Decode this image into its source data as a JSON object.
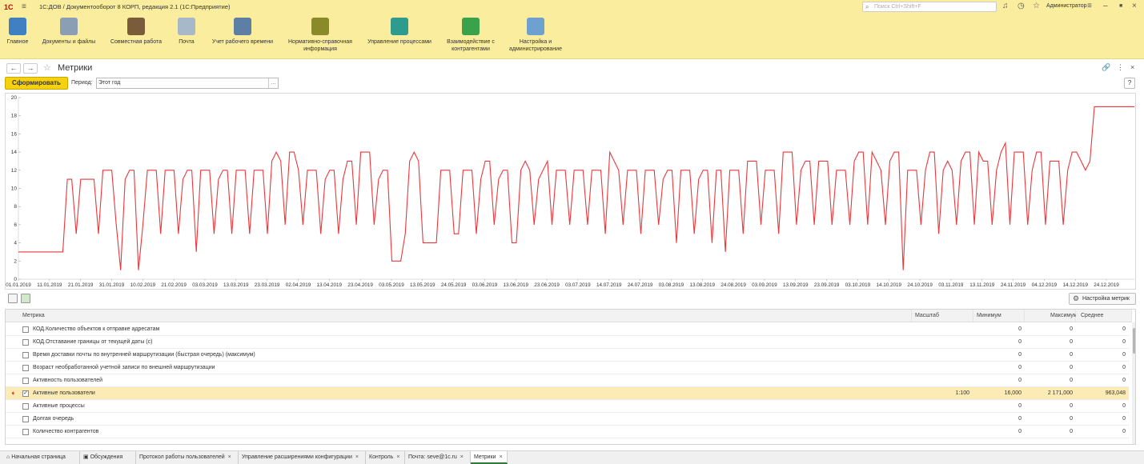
{
  "titlebar": {
    "logo": "1С",
    "title": "1С:ДОВ / Документооборот 8 КОРП, редакция 2.1  (1С:Предприятие)",
    "search_placeholder": "Поиск Ctrl+Shift+F",
    "user": "Администратор"
  },
  "sections": [
    {
      "label": "Главное",
      "color": "#3f7fc2"
    },
    {
      "label": "Документы и файлы",
      "color": "#8a9fb3"
    },
    {
      "label": "Совместная работа",
      "color": "#7a5c3a"
    },
    {
      "label": "Почта",
      "color": "#a7b8c9"
    },
    {
      "label": "Учет рабочего времени",
      "color": "#5d7fa6"
    },
    {
      "label": "Нормативно-справочная информация",
      "color": "#8a8a2a"
    },
    {
      "label": "Управление процессами",
      "color": "#2e9b8f"
    },
    {
      "label": "Взаимодействие с контрагентами",
      "color": "#3aa24a"
    },
    {
      "label": "Настройка и администрирование",
      "color": "#6ea0d0"
    }
  ],
  "form": {
    "title": "Метрики",
    "back": "←",
    "forward": "→",
    "star": "☆",
    "generate_label": "Сформировать",
    "period_label": "Период:",
    "period_value": "Этот год",
    "help": "?"
  },
  "chart_data": {
    "type": "line",
    "title": "",
    "ylim": [
      0,
      20
    ],
    "yticks": [
      0,
      2,
      4,
      6,
      8,
      10,
      12,
      14,
      16,
      18,
      20
    ],
    "xticks": [
      "01.01.2019",
      "11.01.2019",
      "21.01.2019",
      "31.01.2019",
      "10.02.2019",
      "21.02.2019",
      "03.03.2019",
      "13.03.2019",
      "23.03.2019",
      "02.04.2019",
      "13.04.2019",
      "23.04.2019",
      "03.05.2019",
      "13.05.2019",
      "24.05.2019",
      "03.06.2019",
      "13.06.2019",
      "23.06.2019",
      "03.07.2019",
      "14.07.2019",
      "24.07.2019",
      "03.08.2019",
      "13.08.2019",
      "24.08.2019",
      "03.09.2019",
      "13.09.2019",
      "23.09.2019",
      "03.10.2019",
      "14.10.2019",
      "24.10.2019",
      "03.11.2019",
      "13.11.2019",
      "24.11.2019",
      "04.12.2019",
      "14.12.2019",
      "24.12.2019"
    ],
    "series": [
      {
        "color": "#e8383d",
        "values": [
          3,
          3,
          3,
          3,
          3,
          3,
          3,
          3,
          3,
          3,
          3,
          11,
          11,
          5,
          11,
          11,
          11,
          11,
          5,
          12,
          12,
          12,
          6,
          1,
          11,
          12,
          12,
          1,
          6,
          12,
          12,
          12,
          5,
          12,
          12,
          12,
          5,
          11,
          12,
          12,
          3,
          12,
          12,
          12,
          5,
          11,
          12,
          12,
          5,
          12,
          12,
          12,
          5,
          12,
          12,
          12,
          5,
          13,
          14,
          13,
          6,
          14,
          14,
          12,
          6,
          12,
          12,
          12,
          5,
          11,
          12,
          12,
          5,
          11,
          13,
          13,
          6,
          14,
          14,
          14,
          6,
          11,
          12,
          12,
          2,
          2,
          2,
          5,
          13,
          14,
          13,
          4,
          4,
          4,
          4,
          12,
          12,
          12,
          5,
          5,
          12,
          12,
          12,
          5,
          11,
          13,
          13,
          6,
          11,
          12,
          12,
          4,
          4,
          12,
          13,
          12,
          6,
          11,
          12,
          13,
          6,
          12,
          12,
          12,
          6,
          12,
          12,
          12,
          6,
          12,
          12,
          12,
          5,
          14,
          13,
          12,
          6,
          12,
          12,
          12,
          5,
          12,
          12,
          12,
          6,
          11,
          12,
          12,
          4,
          12,
          12,
          12,
          5,
          11,
          12,
          12,
          4,
          12,
          12,
          3,
          12,
          12,
          12,
          5,
          13,
          13,
          13,
          6,
          12,
          12,
          12,
          5,
          14,
          14,
          14,
          6,
          12,
          13,
          13,
          6,
          13,
          13,
          13,
          6,
          12,
          12,
          12,
          6,
          13,
          14,
          14,
          6,
          14,
          13,
          12,
          6,
          13,
          14,
          14,
          1,
          12,
          12,
          12,
          6,
          12,
          14,
          14,
          5,
          12,
          13,
          12,
          6,
          13,
          14,
          14,
          6,
          14,
          13,
          13,
          6,
          12,
          14,
          15,
          6,
          14,
          14,
          14,
          6,
          12,
          14,
          14,
          6,
          13,
          13,
          13,
          6,
          12,
          14,
          14,
          13,
          12,
          13,
          19,
          19,
          19,
          19,
          19,
          19,
          19,
          19,
          19,
          19
        ]
      }
    ]
  },
  "table_toolbar": {
    "settings_label": "Настройка метрик"
  },
  "table": {
    "headers": [
      "Метрика",
      "Масштаб",
      "Минимум",
      "Максимум",
      "Среднее"
    ],
    "rows": [
      {
        "name": "КОД.Количество объектов к отправке адресатам",
        "scale": "",
        "min": "0",
        "max": "0",
        "avg": "0",
        "checked": false,
        "selected": false
      },
      {
        "name": "КОД.Отставание границы от текущей даты (с)",
        "scale": "",
        "min": "0",
        "max": "0",
        "avg": "0",
        "checked": false,
        "selected": false
      },
      {
        "name": "Время доставки почты по внутренней маршрутизации (быстрая очередь) (максимум)",
        "scale": "",
        "min": "0",
        "max": "0",
        "avg": "0",
        "checked": false,
        "selected": false
      },
      {
        "name": "Возраст необработанной учетной записи по внешней маршрутизации",
        "scale": "",
        "min": "0",
        "max": "0",
        "avg": "0",
        "checked": false,
        "selected": false
      },
      {
        "name": "Активность пользователей",
        "scale": "",
        "min": "0",
        "max": "0",
        "avg": "0",
        "checked": false,
        "selected": false
      },
      {
        "name": "Активные пользователи",
        "scale": "1:100",
        "min": "16,000",
        "max": "2 171,000",
        "avg": "963,048",
        "checked": true,
        "selected": true
      },
      {
        "name": "Активные процессы",
        "scale": "",
        "min": "0",
        "max": "0",
        "avg": "0",
        "checked": false,
        "selected": false
      },
      {
        "name": "Долгая очередь",
        "scale": "",
        "min": "0",
        "max": "0",
        "avg": "0",
        "checked": false,
        "selected": false
      },
      {
        "name": "Количество контрагентов",
        "scale": "",
        "min": "0",
        "max": "0",
        "avg": "0",
        "checked": false,
        "selected": false
      }
    ]
  },
  "tabs": [
    {
      "label": "Начальная страница",
      "close": false,
      "active": false
    },
    {
      "label": "Обсуждения",
      "close": false,
      "active": false
    },
    {
      "label": "Протокол работы пользователей",
      "close": true,
      "active": false
    },
    {
      "label": "Управление расширениями конфигурации",
      "close": true,
      "active": false
    },
    {
      "label": "Контроль",
      "close": true,
      "active": false
    },
    {
      "label": "Почта: seve@1c.ru",
      "close": true,
      "active": false
    },
    {
      "label": "Метрики",
      "close": true,
      "active": true
    }
  ]
}
